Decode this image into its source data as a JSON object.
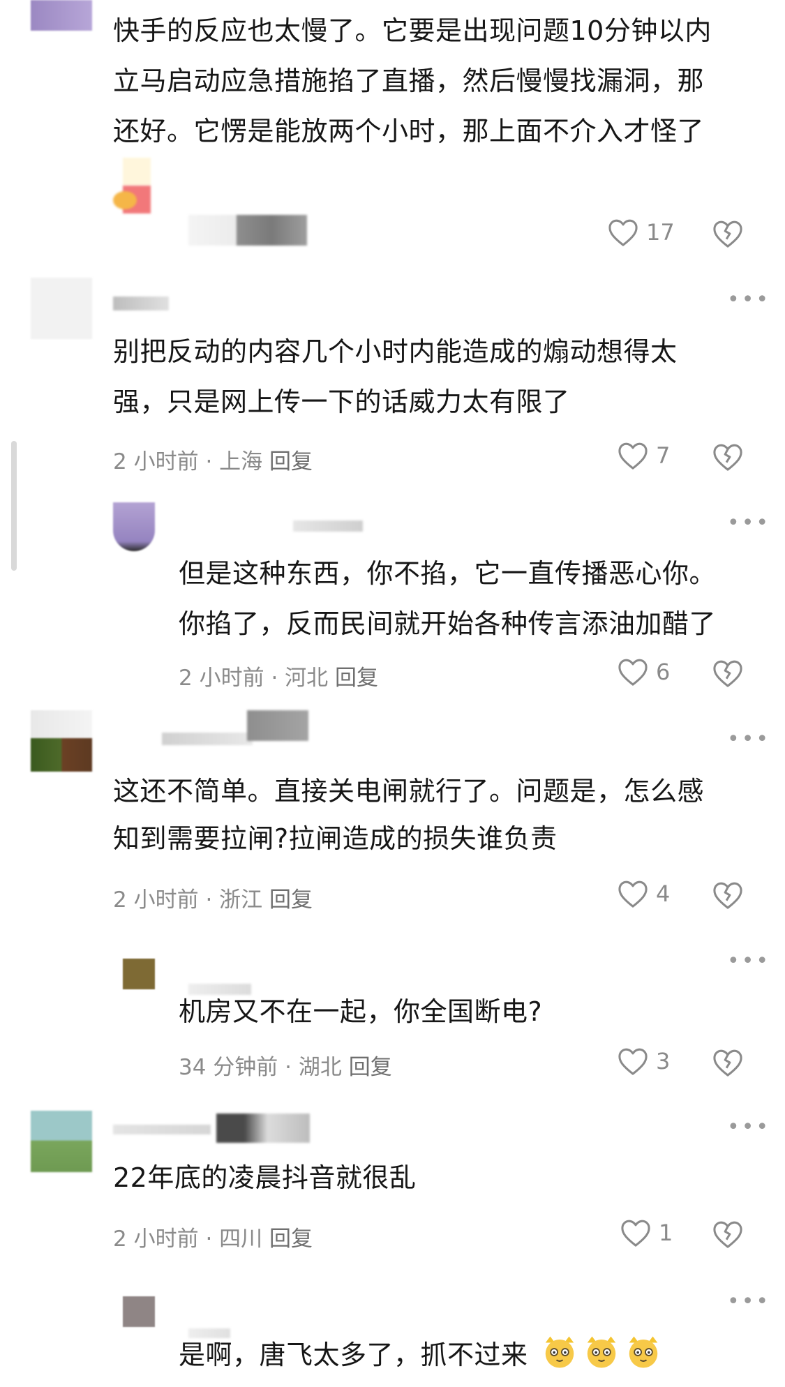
{
  "comments": [
    {
      "text_lines": [
        "快手的反应也太慢了。它要是出现问题10分钟以内",
        "立马启动应急措施掐了直播，然后慢慢找漏洞，那",
        "还好。它愣是能放两个小时，那上面不介入才怪了"
      ],
      "likes": "17"
    },
    {
      "text_lines": [
        "别把反动的内容几个小时内能造成的煽动想得太",
        "强，只是网上传一下的话威力太有限了"
      ],
      "time": "2 小时前",
      "location": "上海",
      "reply_label": "回复",
      "likes": "7"
    },
    {
      "text_lines": [
        "但是这种东西，你不掐，它一直传播恶心你。",
        "你掐了，反而民间就开始各种传言添油加醋了"
      ],
      "time": "2 小时前",
      "location": "河北",
      "reply_label": "回复",
      "likes": "6"
    },
    {
      "text_lines": [
        "这还不简单。直接关电闸就行了。问题是，怎么感",
        "知到需要拉闸?拉闸造成的损失谁负责"
      ],
      "time": "2 小时前",
      "location": "浙江",
      "reply_label": "回复",
      "likes": "4"
    },
    {
      "text_lines": [
        "机房又不在一起，你全国断电?"
      ],
      "time": "34 分钟前",
      "location": "湖北",
      "reply_label": "回复",
      "likes": "3"
    },
    {
      "text_lines": [
        "22年底的凌晨抖音就很乱"
      ],
      "time": "2 小时前",
      "location": "四川",
      "reply_label": "回复",
      "likes": "1"
    },
    {
      "text_lines": [
        "是啊，唐飞太多了，抓不过来"
      ]
    }
  ],
  "separator": "·",
  "icons": {
    "like": "heart-outline-icon",
    "dislike": "broken-heart-icon",
    "more": "more-dots-icon",
    "emoji": "cat-emoji-icon"
  },
  "colors": {
    "text": "#161616",
    "meta": "#8a8a8a",
    "icon": "#8a8a8a"
  }
}
